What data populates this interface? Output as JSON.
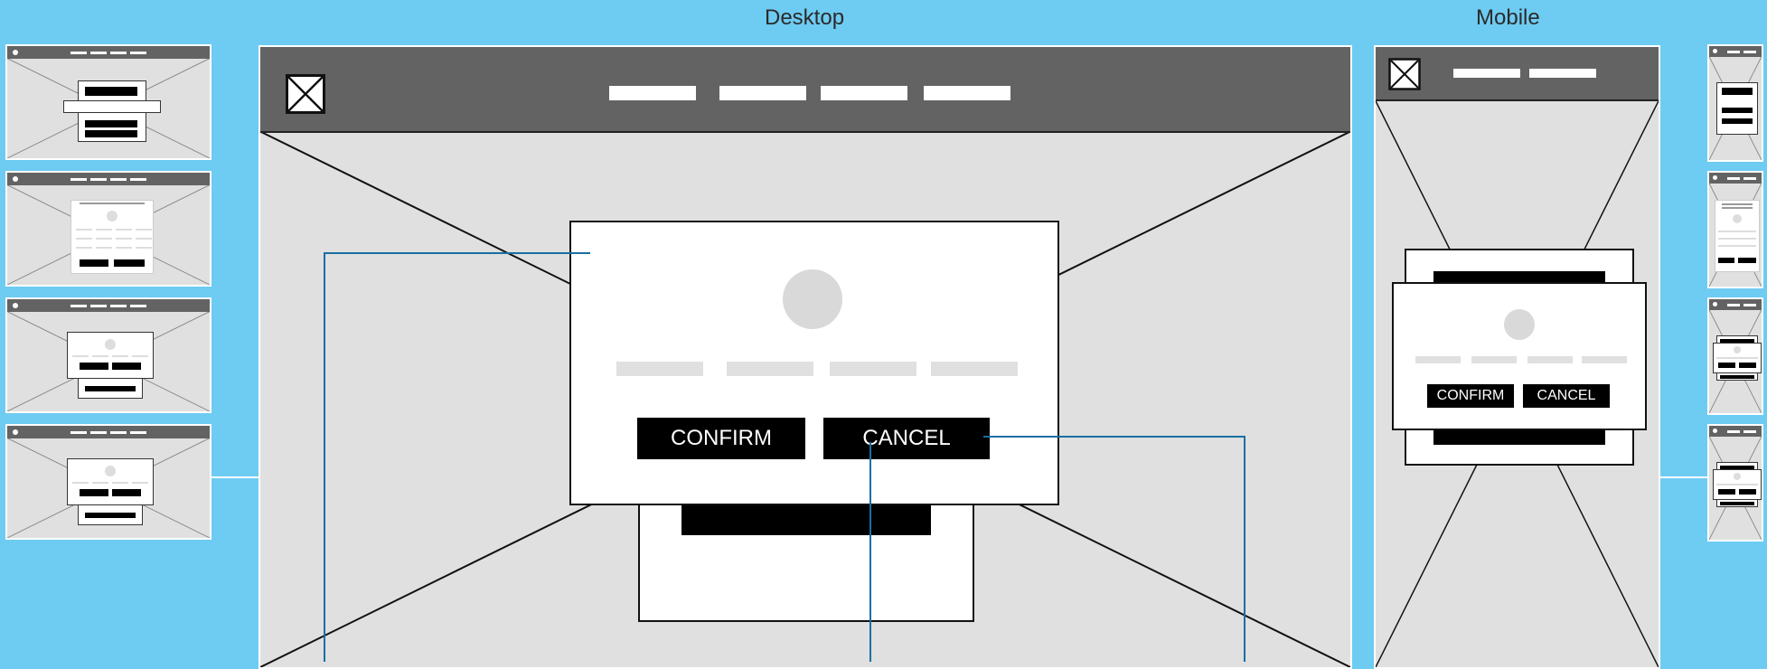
{
  "labels": {
    "desktop": "Desktop",
    "mobile": "Mobile"
  },
  "desktop": {
    "confirm_label": "CONFIRM",
    "cancel_label": "CANCEL"
  },
  "mobile": {
    "confirm_label": "CONFIRM",
    "cancel_label": "CANCEL"
  },
  "icons": {
    "logo": "image-placeholder-icon"
  },
  "colors": {
    "background": "#6ecbf2",
    "frame": "#e0e0e0",
    "topbar": "#636363",
    "button": "#000000",
    "connector": "#1a6fa3"
  }
}
